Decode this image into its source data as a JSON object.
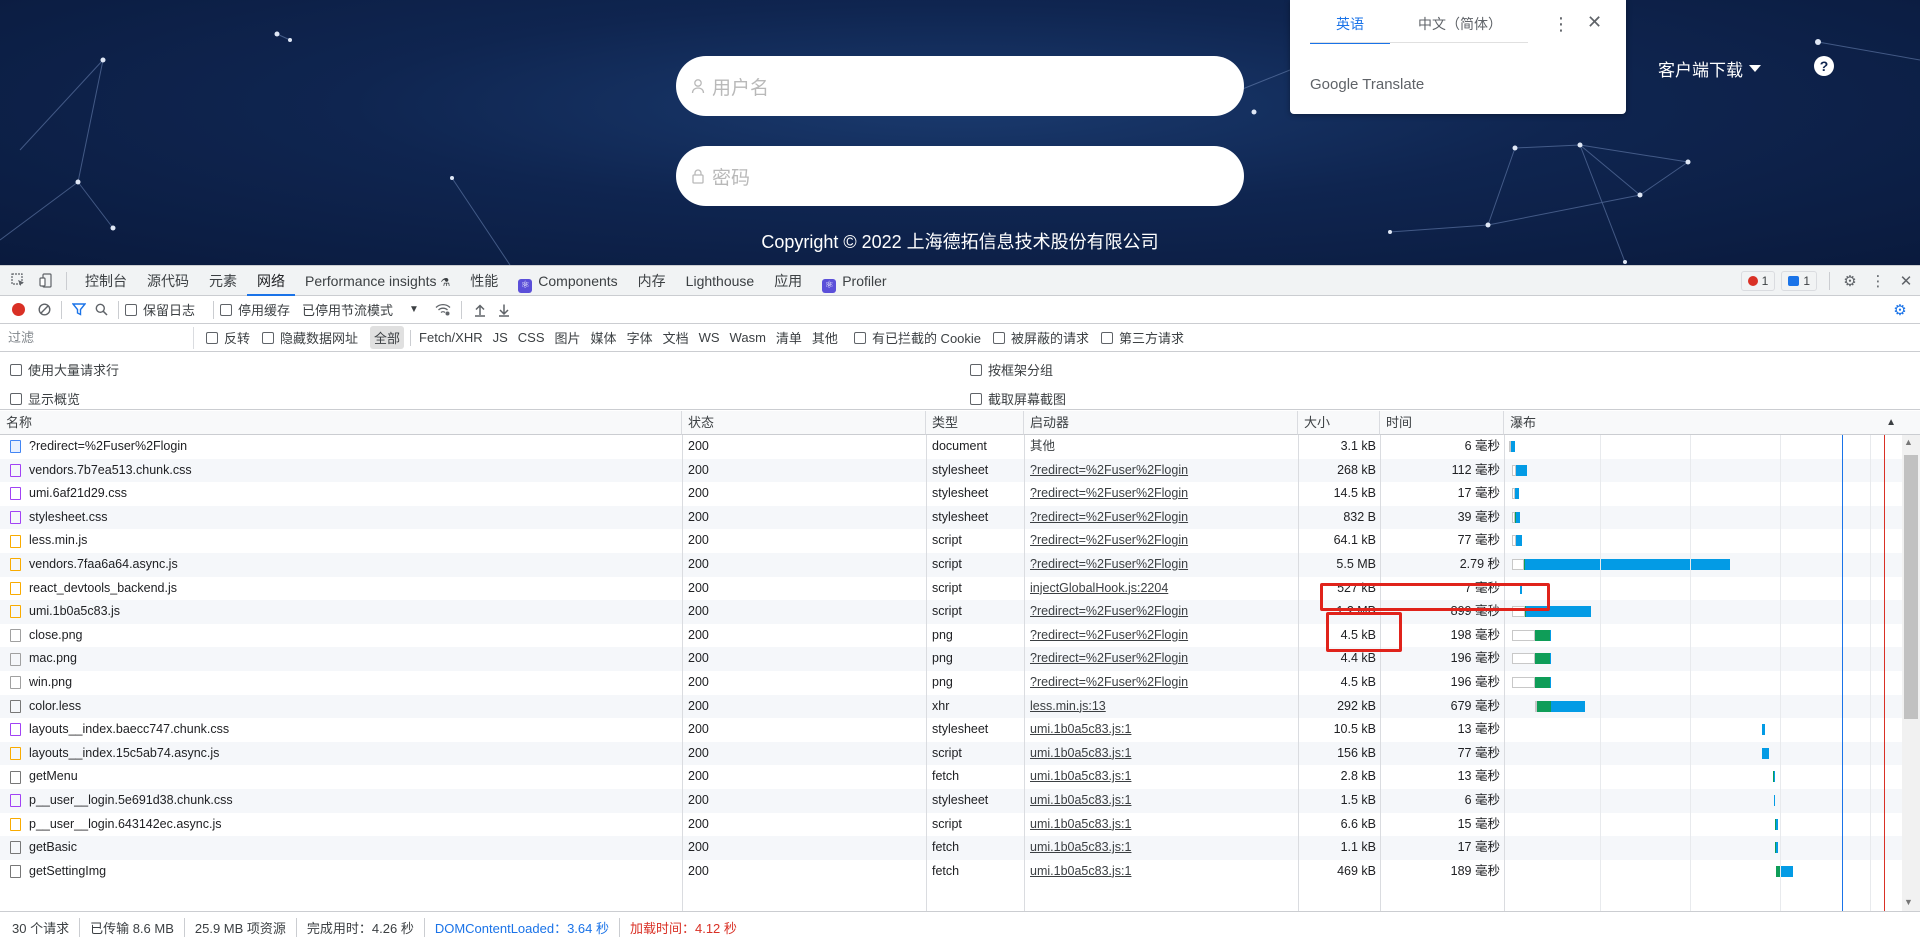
{
  "login": {
    "username_placeholder": "用户名",
    "password_placeholder": "密码",
    "copyright": "Copyright © 2022 上海德拓信息技术股份有限公司",
    "client_download": "客户端下载"
  },
  "translate": {
    "tab_en": "英语",
    "tab_zh": "中文（简体）",
    "brand": "Google Translate"
  },
  "devtools": {
    "tabs": [
      "控制台",
      "源代码",
      "元素",
      "网络",
      "Performance insights",
      "性能",
      "Components",
      "内存",
      "Lighthouse",
      "应用",
      "Profiler"
    ],
    "active_tab": "网络",
    "error_count": "1",
    "message_count": "1",
    "toolbar": {
      "preserve_log": "保留日志",
      "disable_cache": "停用缓存",
      "throttling": "已停用节流模式"
    },
    "filter": {
      "placeholder": "过滤",
      "invert": "反转",
      "hide_data_urls": "隐藏数据网址",
      "types": [
        "全部",
        "Fetch/XHR",
        "JS",
        "CSS",
        "图片",
        "媒体",
        "字体",
        "文档",
        "WS",
        "Wasm",
        "清单",
        "其他"
      ],
      "blocked_cookies": "有已拦截的 Cookie",
      "blocked_requests": "被屏蔽的请求",
      "third_party": "第三方请求"
    },
    "options": {
      "large_rows": "使用大量请求行",
      "group_by_frame": "按框架分组",
      "show_overview": "显示概览",
      "capture_screenshots": "截取屏幕截图"
    },
    "columns": {
      "name": "名称",
      "status": "状态",
      "type": "类型",
      "initiator": "启动器",
      "size": "大小",
      "time": "时间",
      "waterfall": "瀑布"
    },
    "requests": [
      {
        "name": "?redirect=%2Fuser%2Flogin",
        "status": "200",
        "type": "document",
        "initiator": "其他",
        "size": "3.1 kB",
        "time": "6 毫秒",
        "icon": "doc",
        "wf": [
          0.3,
          0.8,
          0.0,
          1.5
        ]
      },
      {
        "name": "vendors.7b7ea513.chunk.css",
        "status": "200",
        "type": "stylesheet",
        "initiator": "?redirect=%2Fuser%2Flogin",
        "size": "268 kB",
        "time": "112 毫秒",
        "icon": "css",
        "wf": [
          1.5,
          1.5,
          0.0,
          4.5
        ]
      },
      {
        "name": "umi.6af21d29.css",
        "status": "200",
        "type": "stylesheet",
        "initiator": "?redirect=%2Fuser%2Flogin",
        "size": "14.5 kB",
        "time": "17 毫秒",
        "icon": "css",
        "wf": [
          1.5,
          1.2,
          0.0,
          1.5
        ]
      },
      {
        "name": "stylesheet.css",
        "status": "200",
        "type": "stylesheet",
        "initiator": "?redirect=%2Fuser%2Flogin",
        "size": "832 B",
        "time": "39 毫秒",
        "icon": "css",
        "wf": [
          1.5,
          1.2,
          0.5,
          1.5
        ]
      },
      {
        "name": "less.min.js",
        "status": "200",
        "type": "script",
        "initiator": "?redirect=%2Fuser%2Flogin",
        "size": "64.1 kB",
        "time": "77 毫秒",
        "icon": "js",
        "wf": [
          1.5,
          1.5,
          0.0,
          2.5
        ]
      },
      {
        "name": "vendors.7faa6a64.async.js",
        "status": "200",
        "type": "script",
        "initiator": "?redirect=%2Fuser%2Flogin",
        "size": "5.5 MB",
        "time": "2.79 秒",
        "icon": "js",
        "wf": [
          1.5,
          4.5,
          0.5,
          79
        ]
      },
      {
        "name": "react_devtools_backend.js",
        "status": "200",
        "type": "script",
        "initiator": "injectGlobalHook.js:2204",
        "size": "527 kB",
        "time": "7 毫秒",
        "icon": "js",
        "wf": [
          4.5,
          0.0,
          0.0,
          1.0
        ]
      },
      {
        "name": "umi.1b0a5c83.js",
        "status": "200",
        "type": "script",
        "initiator": "?redirect=%2Fuser%2Flogin",
        "size": "1.2 MB",
        "time": "899 毫秒",
        "icon": "js",
        "wf": [
          1.5,
          5.0,
          0.5,
          25
        ]
      },
      {
        "name": "close.png",
        "status": "200",
        "type": "png",
        "initiator": "?redirect=%2Fuser%2Flogin",
        "size": "4.5 kB",
        "time": "198 毫秒",
        "icon": "png",
        "wf": [
          1.5,
          9.0,
          5.5,
          0.5
        ]
      },
      {
        "name": "mac.png",
        "status": "200",
        "type": "png",
        "initiator": "?redirect=%2Fuser%2Flogin",
        "size": "4.4 kB",
        "time": "196 毫秒",
        "icon": "png",
        "wf": [
          1.5,
          9.0,
          5.5,
          0.5
        ]
      },
      {
        "name": "win.png",
        "status": "200",
        "type": "png",
        "initiator": "?redirect=%2Fuser%2Flogin",
        "size": "4.5 kB",
        "time": "196 毫秒",
        "icon": "png",
        "wf": [
          1.5,
          9.0,
          5.5,
          0.5
        ]
      },
      {
        "name": "color.less",
        "status": "200",
        "type": "xhr",
        "initiator": "less.min.js:13",
        "size": "292 kB",
        "time": "679 毫秒",
        "icon": "other",
        "wf": [
          10.5,
          0.5,
          5.5,
          13
        ]
      },
      {
        "name": "layouts__index.baecc747.chunk.css",
        "status": "200",
        "type": "stylesheet",
        "initiator": "umi.1b0a5c83.js:1",
        "size": "10.5 kB",
        "time": "13 毫秒",
        "icon": "css",
        "wf": [
          97.5,
          0.0,
          0.0,
          1.2
        ]
      },
      {
        "name": "layouts__index.15c5ab74.async.js",
        "status": "200",
        "type": "script",
        "initiator": "umi.1b0a5c83.js:1",
        "size": "156 kB",
        "time": "77 毫秒",
        "icon": "js",
        "wf": [
          97.5,
          0.0,
          0.0,
          2.8
        ]
      },
      {
        "name": "getMenu",
        "status": "200",
        "type": "fetch",
        "initiator": "umi.1b0a5c83.js:1",
        "size": "2.8 kB",
        "time": "13 毫秒",
        "icon": "other",
        "wf": [
          101.8,
          0.0,
          0.4,
          0.6
        ]
      },
      {
        "name": "p__user__login.5e691d38.chunk.css",
        "status": "200",
        "type": "stylesheet",
        "initiator": "umi.1b0a5c83.js:1",
        "size": "1.5 kB",
        "time": "6 毫秒",
        "icon": "css",
        "wf": [
          102.2,
          0.0,
          0.0,
          0.6
        ]
      },
      {
        "name": "p__user__login.643142ec.async.js",
        "status": "200",
        "type": "script",
        "initiator": "umi.1b0a5c83.js:1",
        "size": "6.6 kB",
        "time": "15 毫秒",
        "icon": "js",
        "wf": [
          102.5,
          0.0,
          0.4,
          0.8
        ]
      },
      {
        "name": "getBasic",
        "status": "200",
        "type": "fetch",
        "initiator": "umi.1b0a5c83.js:1",
        "size": "1.1 kB",
        "time": "17 毫秒",
        "icon": "other",
        "wf": [
          102.8,
          0.0,
          0.4,
          0.8
        ]
      },
      {
        "name": "getSettingImg",
        "status": "200",
        "type": "fetch",
        "initiator": "umi.1b0a5c83.js:1",
        "size": "469 kB",
        "time": "189 毫秒",
        "icon": "other",
        "wf": [
          103.0,
          0.0,
          1.5,
          5.0
        ]
      }
    ],
    "status_bar": {
      "requests": "30 个请求",
      "transferred": "已传输 8.6 MB",
      "resources": "25.9 MB 项资源",
      "finish": "完成用时：4.26 秒",
      "dom_loaded": "DOMContentLoaded：3.64 秒",
      "load": "加载时间：4.12 秒"
    },
    "colors": {
      "accent": "#1a73e8",
      "wf_waiting": "#0f9d58",
      "wf_download": "#039be5",
      "dom_line": "#1a73e8",
      "load_line": "#d93025",
      "highlight": "#e0231b"
    }
  }
}
